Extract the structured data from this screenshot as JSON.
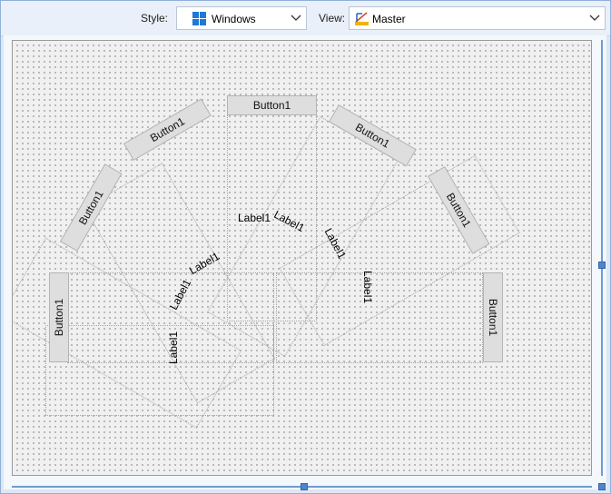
{
  "toolbar": {
    "style_label": "Style:",
    "style_value": "Windows",
    "style_icon": "windows-logo-icon",
    "view_label": "View:",
    "view_value": "Master",
    "view_icon": "master-view-icon"
  },
  "designer": {
    "button_text": "Button1",
    "label_text": "Label1"
  },
  "colors": {
    "accent": "#4f86c9",
    "toolbar_bg": "#e9f0f9",
    "canvas_bg": "#f0f0f0"
  }
}
